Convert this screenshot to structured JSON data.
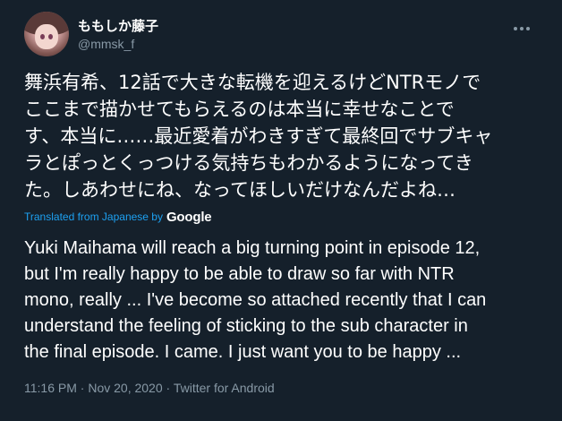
{
  "user": {
    "display_name": "ももしか藤子",
    "handle": "@mmsk_f",
    "avatar_icon": "user-avatar"
  },
  "menu_icon": "more-horizontal-icon",
  "tweet": {
    "text_jp": "舞浜有希、12話で大きな転機を迎えるけどNTRモノで\nここまで描かせてもらえるのは本当に幸せなことで\nす、本当に……最近愛着がわきすぎて最終回でサブキャ\nラとぽっとくっつける気持ちもわかるようになってき\nた。しあわせにね、なってほしいだけなんだよね…",
    "translated_label": "Translated from Japanese by",
    "translated_brand": "Google",
    "text_en": "Yuki Maihama will reach a big turning point in episode 12,\nbut I'm really happy to be able to draw so far with NTR\nmono, really ... I've become so attached recently that I can\nunderstand the feeling of sticking to the sub character in\nthe final episode. I came. I just want you to be happy ...",
    "time": "11:16 PM",
    "separator": "·",
    "date": "Nov 20, 2020",
    "source": "Twitter for Android"
  },
  "colors": {
    "background": "#15202b",
    "text": "#ffffff",
    "muted": "#8899a6",
    "accent": "#1da1f2"
  }
}
